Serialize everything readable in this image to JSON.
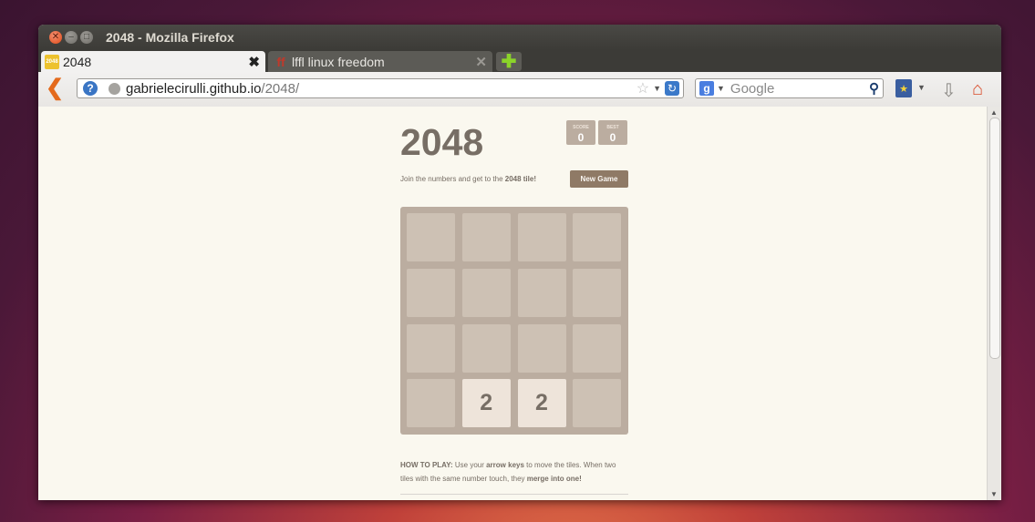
{
  "window": {
    "title": "2048 - Mozilla Firefox"
  },
  "tabs": [
    {
      "label": "2048",
      "favicon": "2048-tile-icon",
      "active": true
    },
    {
      "label": "lffl linux freedom",
      "favicon": "lffl-icon",
      "active": false
    }
  ],
  "newtab_symbol": "✚",
  "nav": {
    "url_host": "gabrielecirulli.github.io",
    "url_path": "/2048/",
    "search_placeholder": "Google",
    "search_engine_letter": "g"
  },
  "game": {
    "title": "2048",
    "score_label": "SCORE",
    "score_value": "0",
    "best_label": "BEST",
    "best_value": "0",
    "intro_prefix": "Join the numbers and get to the ",
    "intro_bold": "2048 tile!",
    "new_game_label": "New Game",
    "grid": [
      [
        "",
        "",
        "",
        ""
      ],
      [
        "",
        "",
        "",
        ""
      ],
      [
        "",
        "",
        "",
        ""
      ],
      [
        "",
        "2",
        "2",
        ""
      ]
    ],
    "howto": {
      "label": "HOW TO PLAY:",
      "text1": " Use your ",
      "bold1": "arrow keys",
      "text2": " to move the tiles. When two tiles with the same number touch, they ",
      "bold2": "merge into one!"
    }
  },
  "colors": {
    "tile_empty": "#cdc1b4",
    "tile_2": "#eee4da",
    "board": "#bbada0",
    "text": "#776e65",
    "button": "#8f7a66"
  }
}
